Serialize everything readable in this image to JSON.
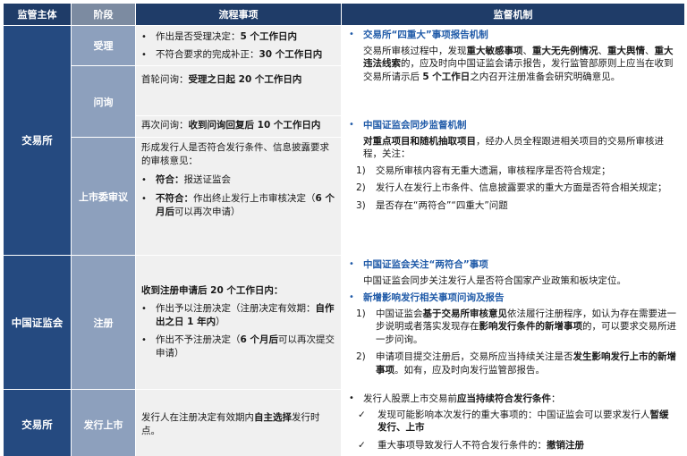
{
  "headers": {
    "subject": "监管主体",
    "stage": "阶段",
    "process": "流程事项",
    "supervision": "监督机制"
  },
  "subjects": {
    "exchange": "交易所",
    "csrc": "中国证监会",
    "exchange2": "交易所"
  },
  "stages": {
    "accept": "受理",
    "inquiry": "问询",
    "listing_review": "上市委审议",
    "registration": "注册",
    "issuance": "发行上市"
  },
  "process": {
    "accept": {
      "b1_pre": "作出是否受理决定：",
      "b1_bold": "5 个工作日内",
      "b2_pre": "不符合要求的完成补正：",
      "b2_bold": "30 个工作日内"
    },
    "inquiry": {
      "r1_pre": "首轮问询：",
      "r1_bold": "受理之日起 20 个工作日内",
      "r2_pre": "再次问询：",
      "r2_bold": "收到问询回复后 10 个工作日内"
    },
    "listing": {
      "intro": "形成发行人是否符合发行条件、信息披露要求的审核意见：",
      "b1_bold": "符合：",
      "b1_text": "报送证监会",
      "b2_bold": "不符合：",
      "b2_text1": "作出终止发行上市审核决定（",
      "b2_bold2": "6 个月后",
      "b2_text2": "可以再次申请）"
    },
    "registration": {
      "intro": "收到注册申请后 20 个工作日内：",
      "b1_text": "作出予以注册决定（注册决定有效期：",
      "b1_bold": "自作出之日 1 年内",
      "b1_end": "）",
      "b2_text": "作出不予注册决定（",
      "b2_bold": "6 个月后",
      "b2_end": "可以再次提交申请）"
    },
    "issuance": {
      "text1": "发行人在注册决定有效期内",
      "bold": "自主选择",
      "text2": "发行时点。"
    }
  },
  "supervision": {
    "exchange_report": {
      "title": "交易所“四重大”事项报告机制",
      "p1": "交易所审核过程中，发现",
      "p2": "重大敏感事项",
      "p3": "、",
      "p4": "重大无先例情况",
      "p5": "、",
      "p6": "重大舆情",
      "p7": "、",
      "p8": "重大违法线索",
      "p9": "的，应及时向中国证监会请示报告，发行监管部原则上应当在收到交易所请示后 ",
      "p10": "5 个工作日",
      "p11": "之内召开注册准备会研究明确意见。"
    },
    "sync": {
      "title": "中国证监会同步监督机制",
      "intro_bold": "对重点项目和随机抽取项目",
      "intro_text": "，经办人员全程跟进相关项目的交易所审核进程，关注：",
      "items": [
        {
          "n": "1)",
          "t": "交易所审核内容有无重大遗漏，审核程序是否符合规定；"
        },
        {
          "n": "2)",
          "t": "发行人在发行上市条件、信息披露要求的重大方面是否符合相关规定；"
        },
        {
          "n": "3)",
          "t": "是否存在“两符合”“四重大”问题"
        }
      ]
    },
    "csrc_focus": {
      "title": "中国证监会关注“两符合”事项",
      "text": "中国证监会同步关注发行人是否符合国家产业政策和板块定位。"
    },
    "new_matters": {
      "title": "新增影响发行相关事项问询及报告",
      "i1_n": "1)",
      "i1_a": "中国证监会",
      "i1_b": "基于交易所审核意见",
      "i1_c": "依法履行注册程序，如认为存在需要进一步说明或者落实发现存在",
      "i1_d": "影响发行条件的新增事项",
      "i1_e": "的，可以要求交易所进一步问询。",
      "i2_n": "2)",
      "i2_a": "申请项目提交注册后，交易所应当持续关注是否",
      "i2_b": "发生影响发行上市的新增事项",
      "i2_c": "。如有，应及时向发行监管部报告。"
    },
    "issuance": {
      "intro_a": "发行人股票上市交易前",
      "intro_b": "应当持续符合发行条件",
      "intro_c": "：",
      "c1_a": "发现可能影响本次发行的重大事项的：中国证监会可以要求发行人",
      "c1_b": "暂缓发行、上市",
      "c2_a": "重大事项导致发行人不符合发行条件的：",
      "c2_b": "撤销注册"
    }
  },
  "colors": {
    "header_dark": "#1f3c68",
    "subject_blue": "#254a80",
    "stage_blue": "#8da0bd",
    "accent_blue": "#1f5aa8"
  }
}
